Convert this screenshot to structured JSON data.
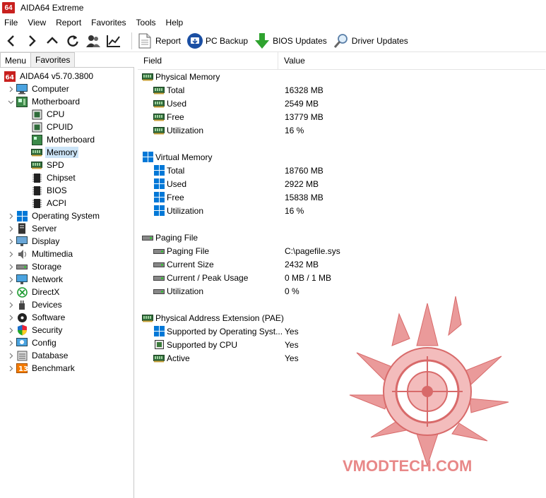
{
  "window": {
    "logo": "64",
    "title": "AIDA64 Extreme"
  },
  "menu": [
    "File",
    "View",
    "Report",
    "Favorites",
    "Tools",
    "Help"
  ],
  "toolbar": {
    "nav_icons": [
      "back-arrow-icon",
      "forward-arrow-icon",
      "up-arrow-icon",
      "refresh-icon",
      "user-icon",
      "chart-icon"
    ],
    "buttons": [
      {
        "label": "Report",
        "icon": "report-icon"
      },
      {
        "label": "PC Backup",
        "icon": "backup-icon"
      },
      {
        "label": "BIOS Updates",
        "icon": "download-arrow-icon"
      },
      {
        "label": "Driver Updates",
        "icon": "magnifier-icon"
      }
    ]
  },
  "tabs": [
    "Menu",
    "Favorites"
  ],
  "tree": {
    "root": "AIDA64 v5.70.3800",
    "items": [
      {
        "label": "Computer",
        "level": 1,
        "chevron": ">"
      },
      {
        "label": "Motherboard",
        "level": 1,
        "chevron": "v"
      },
      {
        "label": "CPU",
        "level": 2
      },
      {
        "label": "CPUID",
        "level": 2
      },
      {
        "label": "Motherboard",
        "level": 2
      },
      {
        "label": "Memory",
        "level": 2,
        "selected": true
      },
      {
        "label": "SPD",
        "level": 2
      },
      {
        "label": "Chipset",
        "level": 2
      },
      {
        "label": "BIOS",
        "level": 2
      },
      {
        "label": "ACPI",
        "level": 2
      },
      {
        "label": "Operating System",
        "level": 1,
        "chevron": ">"
      },
      {
        "label": "Server",
        "level": 1,
        "chevron": ">"
      },
      {
        "label": "Display",
        "level": 1,
        "chevron": ">"
      },
      {
        "label": "Multimedia",
        "level": 1,
        "chevron": ">"
      },
      {
        "label": "Storage",
        "level": 1,
        "chevron": ">"
      },
      {
        "label": "Network",
        "level": 1,
        "chevron": ">"
      },
      {
        "label": "DirectX",
        "level": 1,
        "chevron": ">"
      },
      {
        "label": "Devices",
        "level": 1,
        "chevron": ">"
      },
      {
        "label": "Software",
        "level": 1,
        "chevron": ">"
      },
      {
        "label": "Security",
        "level": 1,
        "chevron": ">"
      },
      {
        "label": "Config",
        "level": 1,
        "chevron": ">"
      },
      {
        "label": "Database",
        "level": 1,
        "chevron": ">"
      },
      {
        "label": "Benchmark",
        "level": 1,
        "chevron": ">"
      }
    ]
  },
  "columns": {
    "field": "Field",
    "value": "Value"
  },
  "sections": [
    {
      "title": "Physical Memory",
      "icon": "ram",
      "rows": [
        {
          "field": "Total",
          "value": "16328 MB"
        },
        {
          "field": "Used",
          "value": "2549 MB"
        },
        {
          "field": "Free",
          "value": "13779 MB"
        },
        {
          "field": "Utilization",
          "value": "16 %"
        }
      ]
    },
    {
      "title": "Virtual Memory",
      "icon": "windows",
      "rows": [
        {
          "field": "Total",
          "value": "18760 MB"
        },
        {
          "field": "Used",
          "value": "2922 MB"
        },
        {
          "field": "Free",
          "value": "15838 MB"
        },
        {
          "field": "Utilization",
          "value": "16 %"
        }
      ]
    },
    {
      "title": "Paging File",
      "icon": "drive",
      "rows": [
        {
          "field": "Paging File",
          "value": "C:\\pagefile.sys"
        },
        {
          "field": "Current Size",
          "value": "2432 MB"
        },
        {
          "field": "Current / Peak Usage",
          "value": "0 MB / 1 MB"
        },
        {
          "field": "Utilization",
          "value": "0 %"
        }
      ]
    },
    {
      "title": "Physical Address Extension (PAE)",
      "icon": "ram",
      "rows": [
        {
          "field": "Supported by Operating Syst...",
          "value": "Yes",
          "icon": "windows"
        },
        {
          "field": "Supported by CPU",
          "value": "Yes",
          "icon": "chip"
        },
        {
          "field": "Active",
          "value": "Yes",
          "icon": "ram"
        }
      ]
    }
  ],
  "watermark": {
    "text": "VMODTECH.COM"
  },
  "colors": {
    "selection": "#cce4f7",
    "windows_blue": "#0078d7",
    "ram_green": "#2f6b3a",
    "logo_red": "#c8201e",
    "watermark": "#e88888"
  }
}
